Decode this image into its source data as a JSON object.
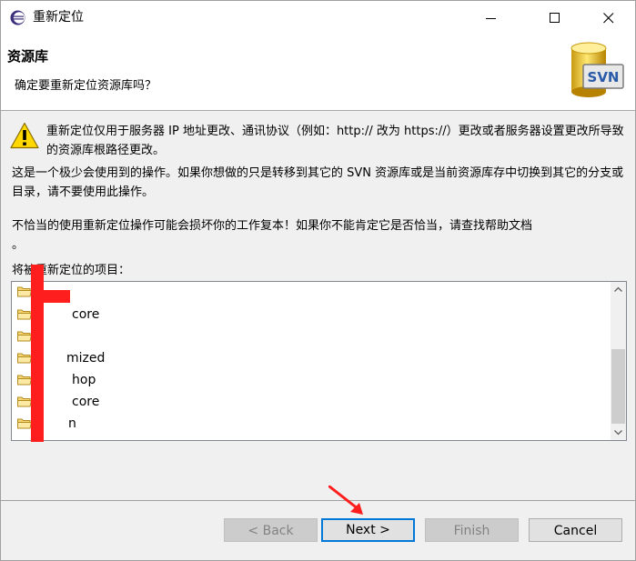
{
  "window": {
    "title": "重新定位"
  },
  "header": {
    "title": "资源库",
    "description": "确定要重新定位资源库吗？",
    "logo_text": "SVN"
  },
  "body": {
    "warning": "重新定位仅用于服务器 IP 地址更改、通讯协议（例如：http:// 改为 https://）更改或者服务器设置更改所导致的资源库根路径更改。",
    "paragraph1": "这是一个极少会使用到的操作。如果你想做的只是转移到其它的 SVN 资源库或是当前资源库存中切换到其它的分支或目录，请不要使用此操作。",
    "paragraph2": "不恰当的使用重新定位操作可能会损坏你的工作复本！如果你不能肯定它是否恰当，请查找帮助文档",
    "paragraph2_tail": "。",
    "list_label": "将被重新定位的项目："
  },
  "list": {
    "items": [
      {
        "label": ""
      },
      {
        "label": "core"
      },
      {
        "label": ""
      },
      {
        "label": "mized"
      },
      {
        "label": "hop"
      },
      {
        "label": "core"
      },
      {
        "label": "n"
      }
    ]
  },
  "buttons": {
    "back": "< Back",
    "next": "Next >",
    "finish": "Finish",
    "cancel": "Cancel"
  },
  "colors": {
    "accent": "#0078d7",
    "annotation": "#ff1e1e"
  }
}
